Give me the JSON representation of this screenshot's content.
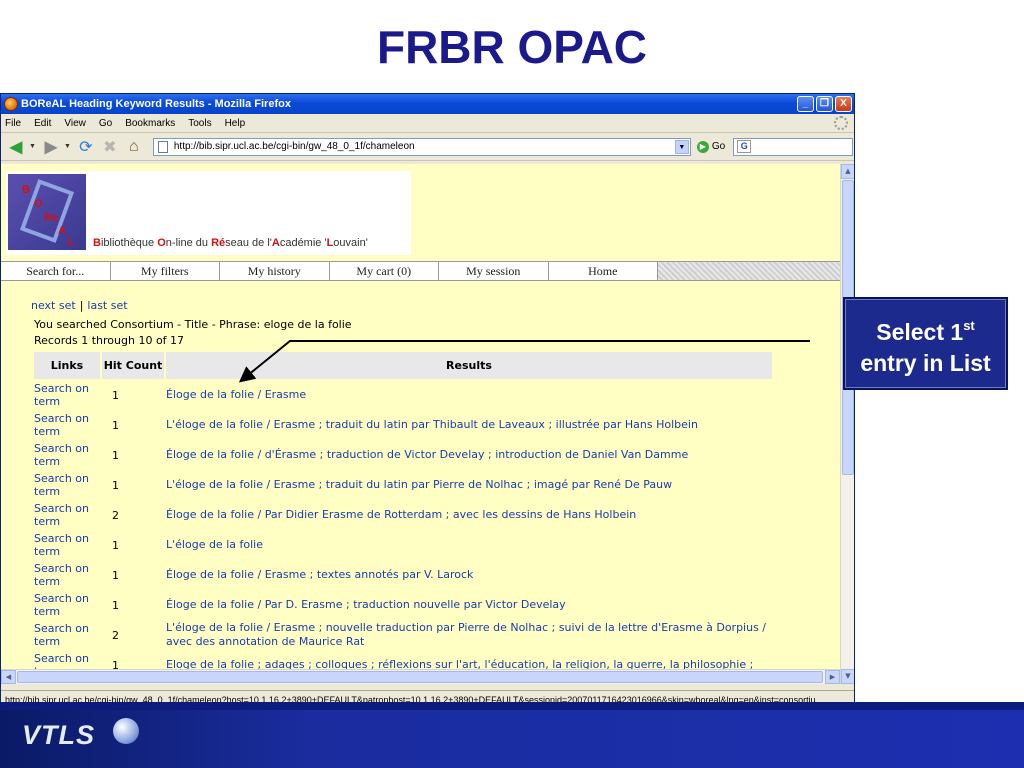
{
  "slide": {
    "title": "FRBR OPAC",
    "callout_line1_pre": "Select 1",
    "callout_line1_sup": "st",
    "callout_line2": "entry in List",
    "footer_logo": "VTLS"
  },
  "browser": {
    "window_title": "BOReAL Heading Keyword Results - Mozilla Firefox",
    "window_buttons": [
      "_",
      "❐",
      "X"
    ],
    "menu": [
      "File",
      "Edit",
      "View",
      "Go",
      "Bookmarks",
      "Tools",
      "Help"
    ],
    "url": "http://bib.sipr.ucl.ac.be/cgi-bin/gw_48_0_1f/chameleon",
    "go_label": "Go",
    "search_engine_letter": "G",
    "status_text": "http://bib.sipr.ucl.ac.be/cgi-bin/gw_48_0_1f/chameleon?host=10.1.16.2+3890+DEFAULT&patronhost=10.1.16.2+3890+DEFAULT&sessionid=2007011716423016966&skin=wboreal&lng=en&inst=consortiu..."
  },
  "site": {
    "logo_letters": [
      "B",
      "O",
      "Re",
      "A",
      "L"
    ],
    "caption": {
      "b": "B",
      "p1": "ibliothèque ",
      "o": "O",
      "p2": "n-line du ",
      "re": "Ré",
      "p3": "seau de l'",
      "a": "A",
      "p4": "cadémie '",
      "l": "L",
      "p5": "ouvain'"
    },
    "tabs": [
      "Search for...",
      "My filters",
      "My history",
      "My cart (0)",
      "My session",
      "Home"
    ],
    "next_set": "next set",
    "separator": "|",
    "last_set": "last set",
    "searched_text": "You searched Consortium - Title - Phrase: eloge de la folie",
    "records_text": "Records 1 through 10 of 17",
    "columns": {
      "links": "Links",
      "hit_count": "Hit Count",
      "results": "Results"
    },
    "rows": [
      {
        "link": "Search on term",
        "count": "1",
        "result": "Éloge de la folie / Erasme"
      },
      {
        "link": "Search on term",
        "count": "1",
        "result": "L'éloge de la folie / Erasme ; traduit du latin par Thibault de Laveaux ; illustrée par Hans Holbein"
      },
      {
        "link": "Search on term",
        "count": "1",
        "result": "Éloge de la folie / d'Érasme ; traduction de Victor Develay ; introduction de Daniel Van Damme"
      },
      {
        "link": "Search on term",
        "count": "1",
        "result": "L'éloge de la folie / Erasme ; traduit du latin par Pierre de Nolhac ; imagé par René De Pauw"
      },
      {
        "link": "Search on term",
        "count": "2",
        "result": "Éloge de la folie / Par Didier Erasme de Rotterdam ; avec les dessins de Hans Holbein"
      },
      {
        "link": "Search on term",
        "count": "1",
        "result": "L'éloge de la folie"
      },
      {
        "link": "Search on term",
        "count": "1",
        "result": "Éloge de la folie / Erasme ; textes annotés par V. Larock"
      },
      {
        "link": "Search on term",
        "count": "1",
        "result": "Éloge de la folie / Par D. Erasme ; traduction nouvelle par Victor Develay"
      },
      {
        "link": "Search on term",
        "count": "2",
        "result": "L'éloge de la folie / Erasme ; nouvelle traduction par Pierre de Nolhac ; suivi de la lettre d'Erasme à Dorpius / avec des annotation de Maurice Rat"
      },
      {
        "link": "Search on term",
        "count": "1",
        "result": "Eloge de la folie ; adages ; colloques ; réflexions sur l'art, l'éducation, la religion, la guerre, la philosophie ;"
      }
    ]
  }
}
